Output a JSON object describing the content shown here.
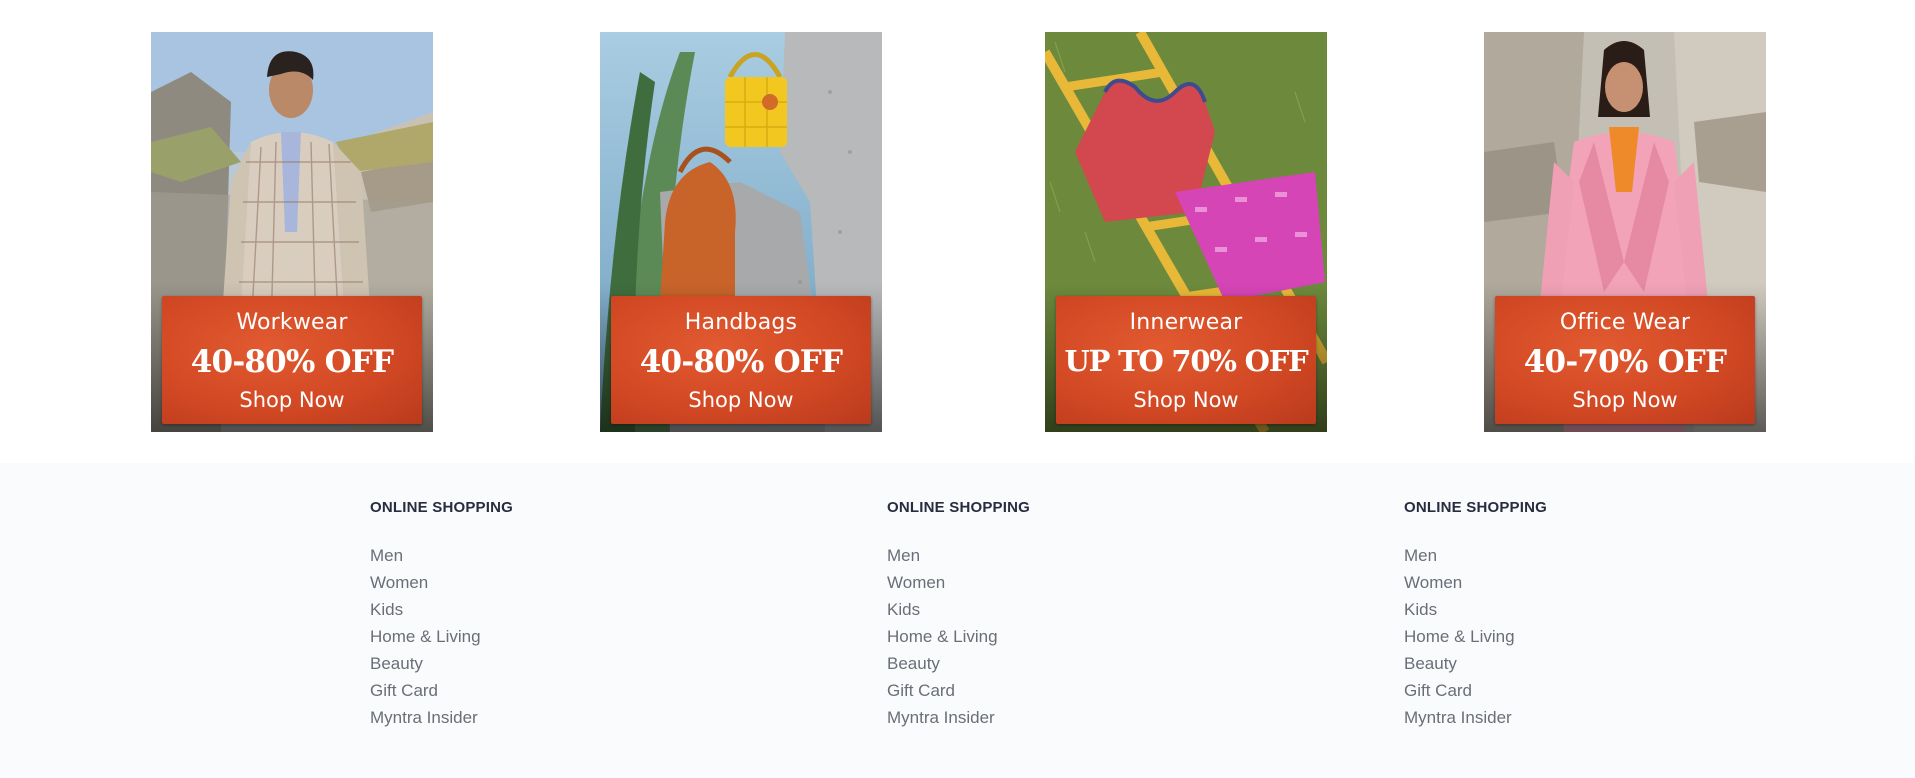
{
  "banners": [
    {
      "category": "Workwear",
      "discount": "40-80% OFF",
      "cta": "Shop Now",
      "photo": "man-in-checked-blazer-on-rocks",
      "accent": "#d94a25"
    },
    {
      "category": "Handbags",
      "discount": "40-80% OFF",
      "cta": "Shop Now",
      "photo": "yellow-and-orange-handbags-on-stone",
      "accent": "#d94a25"
    },
    {
      "category": "Innerwear",
      "discount": "UP TO 70% OFF",
      "cta": "Shop Now",
      "photo": "vest-and-shorts-on-ladder-in-grass",
      "accent": "#d94a25"
    },
    {
      "category": "Office Wear",
      "discount": "40-70% OFF",
      "cta": "Shop Now",
      "photo": "woman-in-pink-suit-on-rocks",
      "accent": "#d94a25"
    }
  ],
  "footer": {
    "columns": [
      {
        "heading": "ONLINE SHOPPING",
        "links": [
          "Men",
          "Women",
          "Kids",
          "Home & Living",
          "Beauty",
          "Gift Card",
          "Myntra Insider"
        ]
      },
      {
        "heading": "ONLINE SHOPPING",
        "links": [
          "Men",
          "Women",
          "Kids",
          "Home & Living",
          "Beauty",
          "Gift Card",
          "Myntra Insider"
        ]
      },
      {
        "heading": "ONLINE SHOPPING",
        "links": [
          "Men",
          "Women",
          "Kids",
          "Home & Living",
          "Beauty",
          "Gift Card",
          "Myntra Insider"
        ]
      }
    ]
  },
  "colors": {
    "heading": "#282c3f",
    "link": "#696e79",
    "footer_bg": "#fafbfc",
    "offer_orange": "#d94a25"
  }
}
